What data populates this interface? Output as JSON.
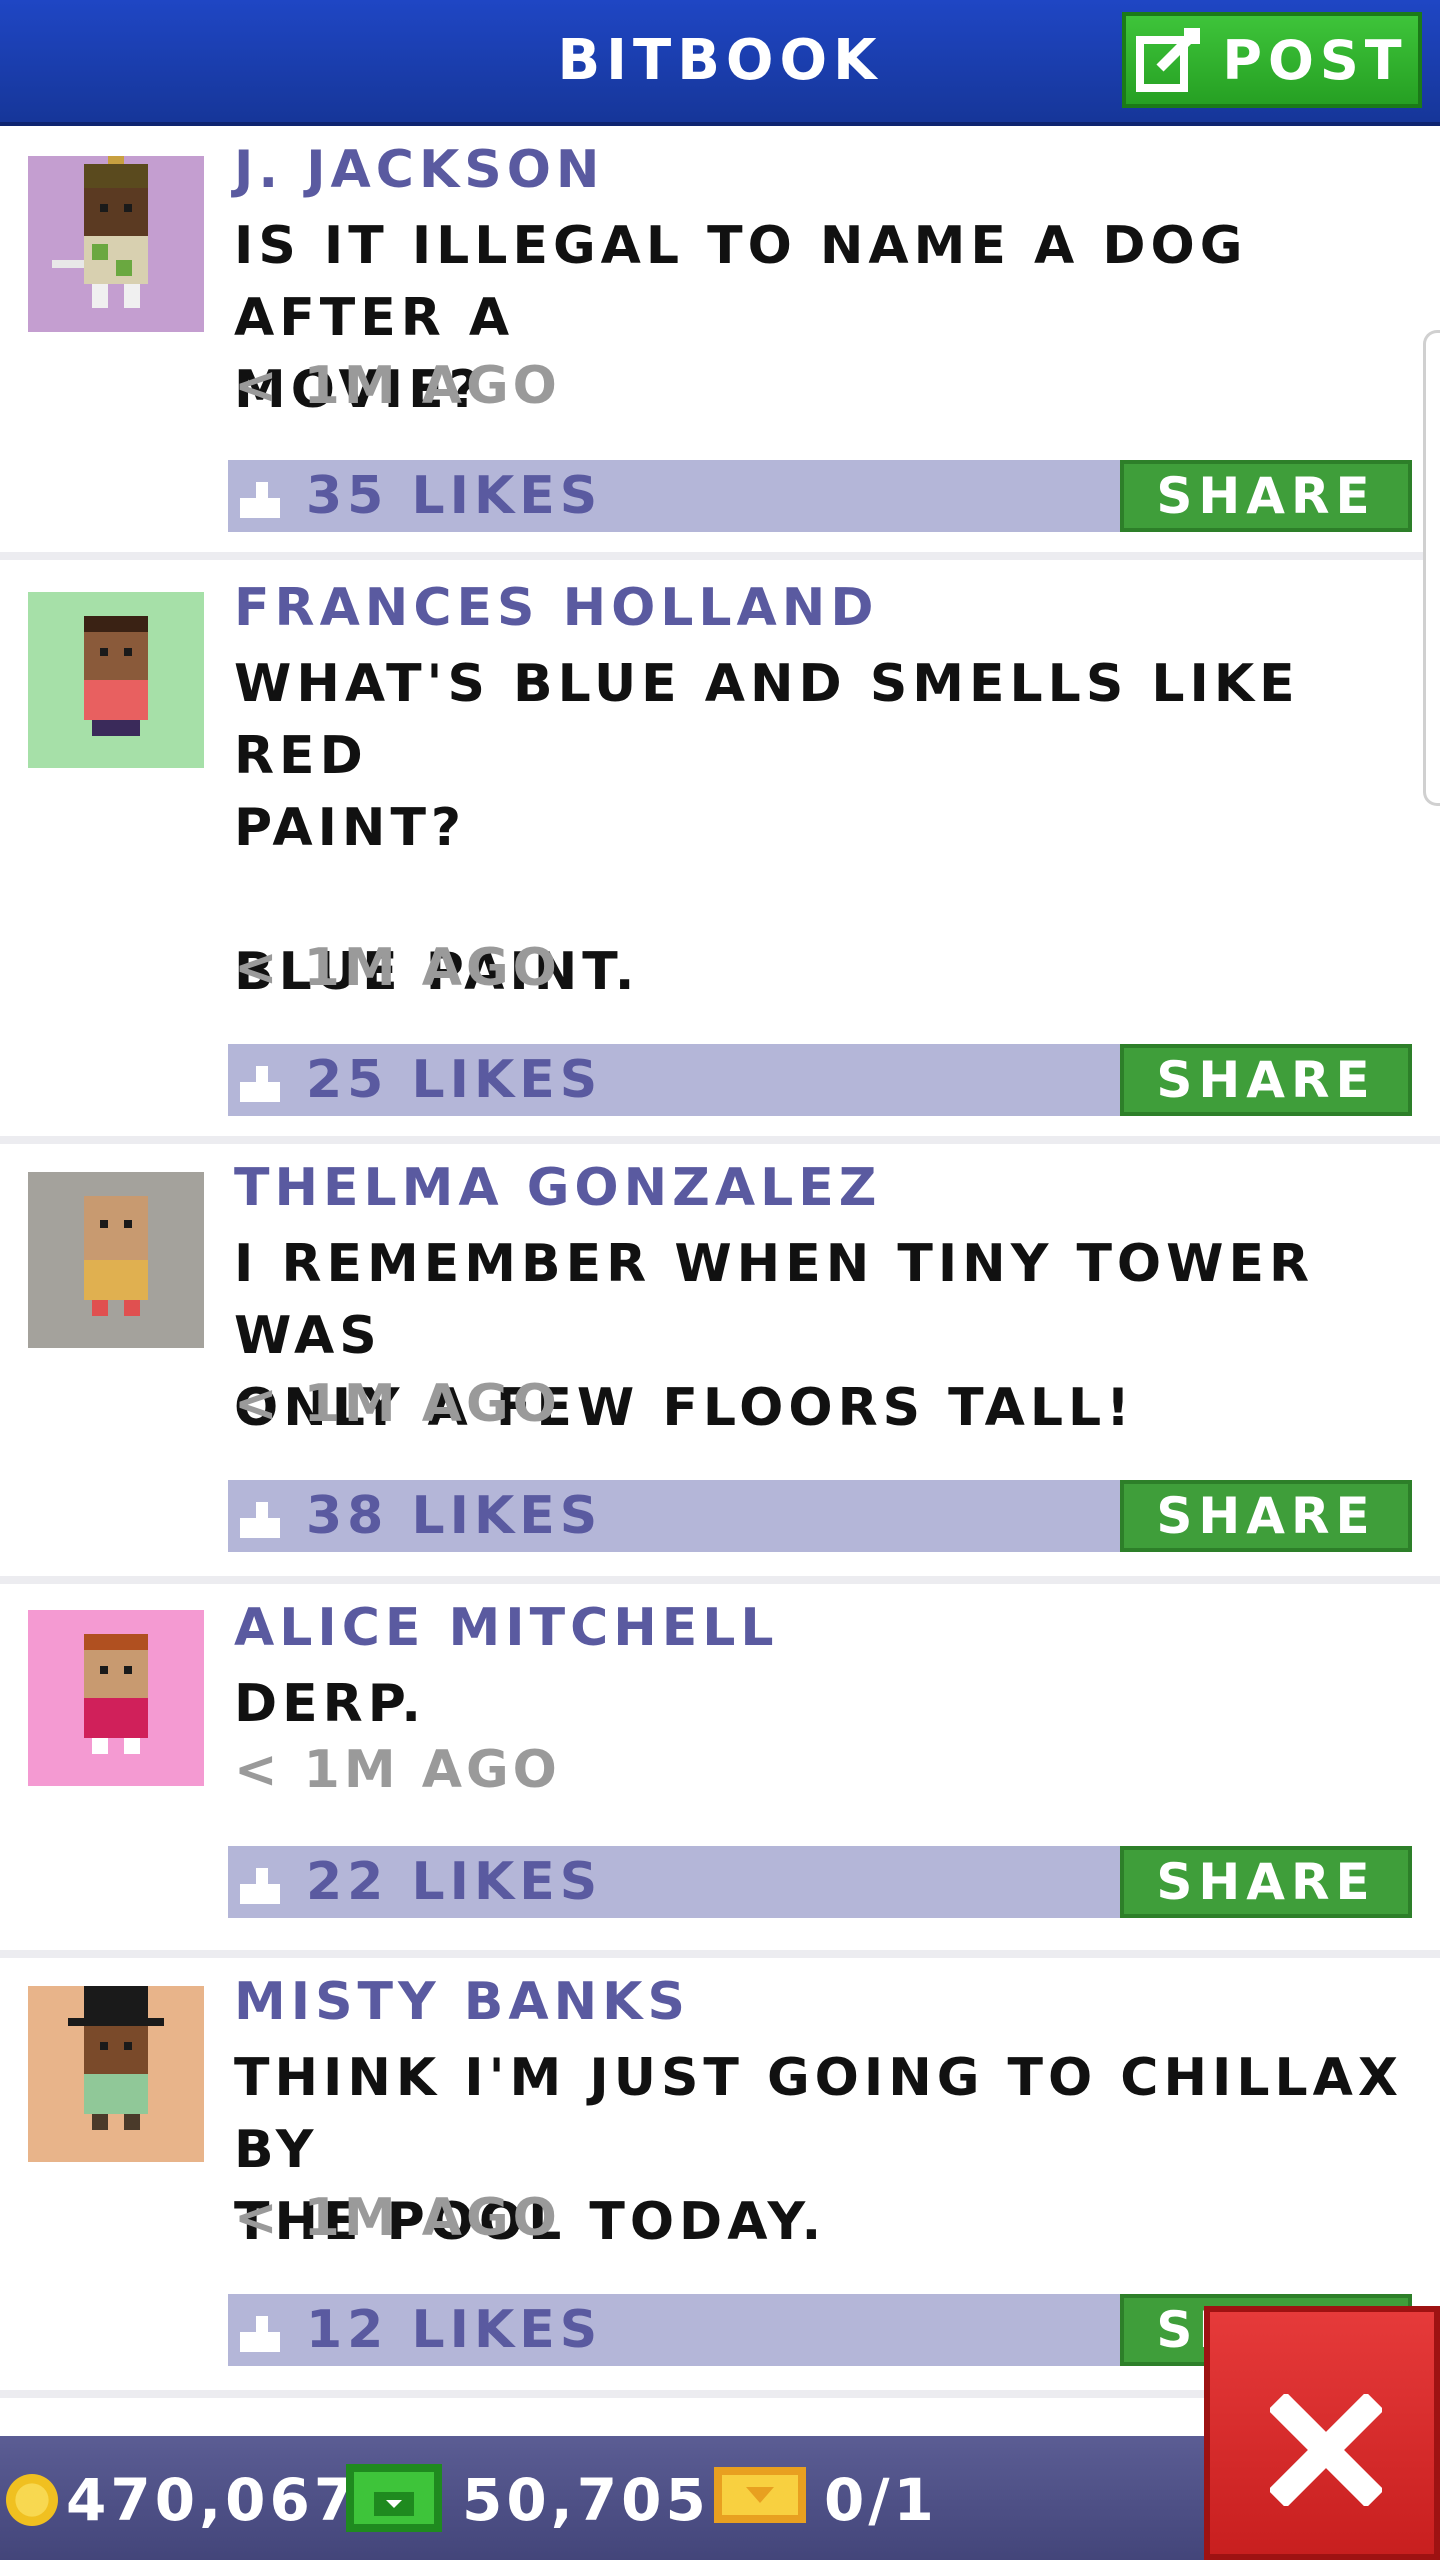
{
  "header": {
    "title": "BITBOOK",
    "post_label": "POST"
  },
  "posts": [
    {
      "name": "J. JACKSON",
      "message": "IS IT ILLEGAL TO NAME A DOG AFTER A\nMOVIE?",
      "time": "< 1M AGO",
      "likes": "35 LIKES",
      "share_label": "SHARE",
      "avatar_bg": "#c49ed0"
    },
    {
      "name": "FRANCES HOLLAND",
      "message": "WHAT'S BLUE AND SMELLS LIKE RED\nPAINT?\n\nBLUE PAINT.",
      "time": "< 1M AGO",
      "likes": "25 LIKES",
      "share_label": "SHARE",
      "avatar_bg": "#a6e0a8"
    },
    {
      "name": "THELMA GONZALEZ",
      "message": "I REMEMBER WHEN TINY TOWER WAS\nONLY A FEW FLOORS TALL!",
      "time": "< 1M AGO",
      "likes": "38 LIKES",
      "share_label": "SHARE",
      "avatar_bg": "#a4a29c"
    },
    {
      "name": "ALICE MITCHELL",
      "message": "DERP.",
      "time": "< 1M AGO",
      "likes": "22 LIKES",
      "share_label": "SHARE",
      "avatar_bg": "#f49ad2"
    },
    {
      "name": "MISTY BANKS",
      "message": "THINK I'M JUST GOING TO CHILLAX BY\nTHE POOL TODAY.",
      "time": "< 1M AGO",
      "likes": "12 LIKES",
      "share_label": "SHARE",
      "avatar_bg": "#e8b48a"
    }
  ],
  "footer": {
    "coins": "470,067",
    "bux": "50,705",
    "tickets": "0/1"
  },
  "colors": {
    "header": "#1f46c4",
    "accent_green": "#3f9e3a",
    "likes_bar": "#b4b6d8",
    "name_text": "#5a5aa0",
    "close_red": "#d42a2a"
  },
  "icons": {
    "post": "edit-icon",
    "like": "thumbs-up-icon",
    "coin": "coin-icon",
    "bux": "bux-icon",
    "ticket": "ticket-icon",
    "close": "close-icon"
  }
}
